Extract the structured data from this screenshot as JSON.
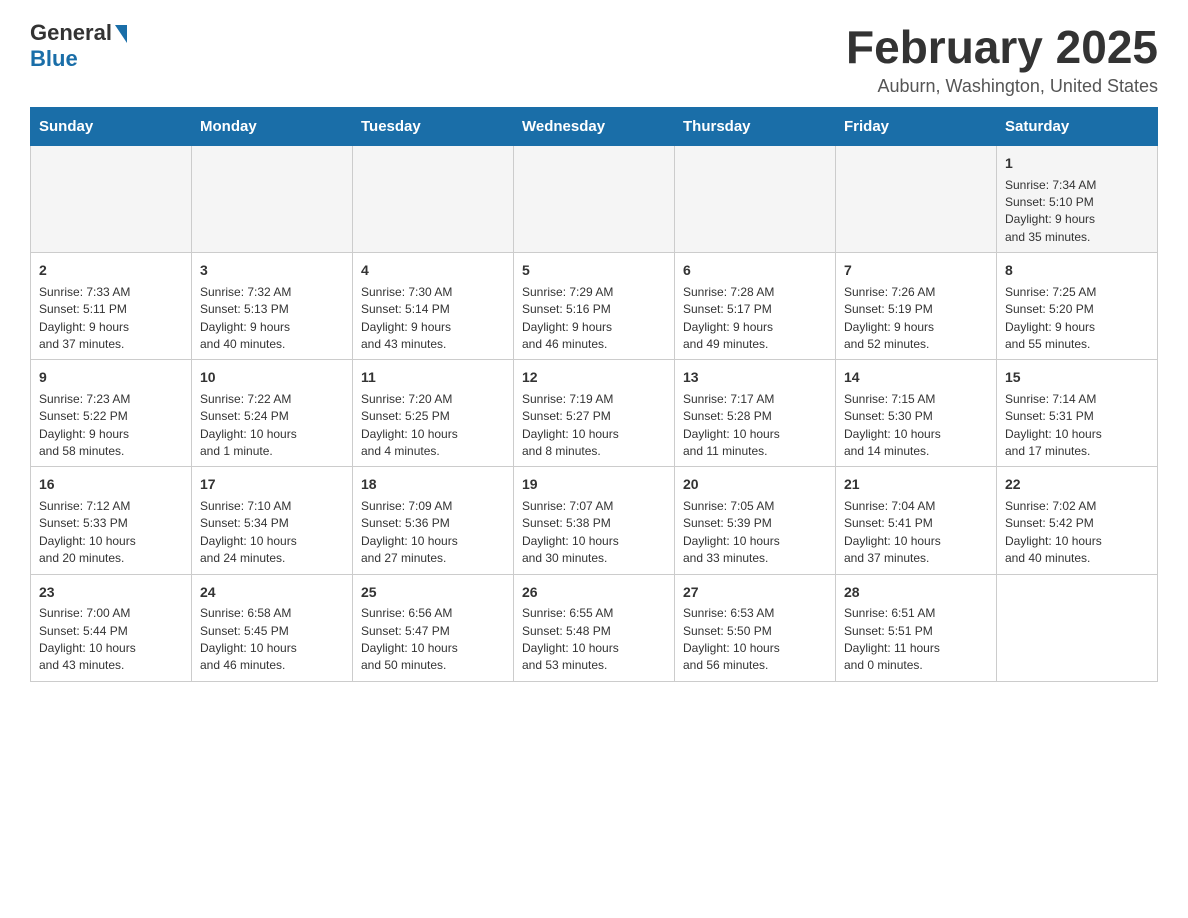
{
  "header": {
    "logo_general": "General",
    "logo_blue": "Blue",
    "month_title": "February 2025",
    "location": "Auburn, Washington, United States"
  },
  "weekdays": [
    "Sunday",
    "Monday",
    "Tuesday",
    "Wednesday",
    "Thursday",
    "Friday",
    "Saturday"
  ],
  "weeks": [
    [
      {
        "day": "",
        "info": ""
      },
      {
        "day": "",
        "info": ""
      },
      {
        "day": "",
        "info": ""
      },
      {
        "day": "",
        "info": ""
      },
      {
        "day": "",
        "info": ""
      },
      {
        "day": "",
        "info": ""
      },
      {
        "day": "1",
        "info": "Sunrise: 7:34 AM\nSunset: 5:10 PM\nDaylight: 9 hours\nand 35 minutes."
      }
    ],
    [
      {
        "day": "2",
        "info": "Sunrise: 7:33 AM\nSunset: 5:11 PM\nDaylight: 9 hours\nand 37 minutes."
      },
      {
        "day": "3",
        "info": "Sunrise: 7:32 AM\nSunset: 5:13 PM\nDaylight: 9 hours\nand 40 minutes."
      },
      {
        "day": "4",
        "info": "Sunrise: 7:30 AM\nSunset: 5:14 PM\nDaylight: 9 hours\nand 43 minutes."
      },
      {
        "day": "5",
        "info": "Sunrise: 7:29 AM\nSunset: 5:16 PM\nDaylight: 9 hours\nand 46 minutes."
      },
      {
        "day": "6",
        "info": "Sunrise: 7:28 AM\nSunset: 5:17 PM\nDaylight: 9 hours\nand 49 minutes."
      },
      {
        "day": "7",
        "info": "Sunrise: 7:26 AM\nSunset: 5:19 PM\nDaylight: 9 hours\nand 52 minutes."
      },
      {
        "day": "8",
        "info": "Sunrise: 7:25 AM\nSunset: 5:20 PM\nDaylight: 9 hours\nand 55 minutes."
      }
    ],
    [
      {
        "day": "9",
        "info": "Sunrise: 7:23 AM\nSunset: 5:22 PM\nDaylight: 9 hours\nand 58 minutes."
      },
      {
        "day": "10",
        "info": "Sunrise: 7:22 AM\nSunset: 5:24 PM\nDaylight: 10 hours\nand 1 minute."
      },
      {
        "day": "11",
        "info": "Sunrise: 7:20 AM\nSunset: 5:25 PM\nDaylight: 10 hours\nand 4 minutes."
      },
      {
        "day": "12",
        "info": "Sunrise: 7:19 AM\nSunset: 5:27 PM\nDaylight: 10 hours\nand 8 minutes."
      },
      {
        "day": "13",
        "info": "Sunrise: 7:17 AM\nSunset: 5:28 PM\nDaylight: 10 hours\nand 11 minutes."
      },
      {
        "day": "14",
        "info": "Sunrise: 7:15 AM\nSunset: 5:30 PM\nDaylight: 10 hours\nand 14 minutes."
      },
      {
        "day": "15",
        "info": "Sunrise: 7:14 AM\nSunset: 5:31 PM\nDaylight: 10 hours\nand 17 minutes."
      }
    ],
    [
      {
        "day": "16",
        "info": "Sunrise: 7:12 AM\nSunset: 5:33 PM\nDaylight: 10 hours\nand 20 minutes."
      },
      {
        "day": "17",
        "info": "Sunrise: 7:10 AM\nSunset: 5:34 PM\nDaylight: 10 hours\nand 24 minutes."
      },
      {
        "day": "18",
        "info": "Sunrise: 7:09 AM\nSunset: 5:36 PM\nDaylight: 10 hours\nand 27 minutes."
      },
      {
        "day": "19",
        "info": "Sunrise: 7:07 AM\nSunset: 5:38 PM\nDaylight: 10 hours\nand 30 minutes."
      },
      {
        "day": "20",
        "info": "Sunrise: 7:05 AM\nSunset: 5:39 PM\nDaylight: 10 hours\nand 33 minutes."
      },
      {
        "day": "21",
        "info": "Sunrise: 7:04 AM\nSunset: 5:41 PM\nDaylight: 10 hours\nand 37 minutes."
      },
      {
        "day": "22",
        "info": "Sunrise: 7:02 AM\nSunset: 5:42 PM\nDaylight: 10 hours\nand 40 minutes."
      }
    ],
    [
      {
        "day": "23",
        "info": "Sunrise: 7:00 AM\nSunset: 5:44 PM\nDaylight: 10 hours\nand 43 minutes."
      },
      {
        "day": "24",
        "info": "Sunrise: 6:58 AM\nSunset: 5:45 PM\nDaylight: 10 hours\nand 46 minutes."
      },
      {
        "day": "25",
        "info": "Sunrise: 6:56 AM\nSunset: 5:47 PM\nDaylight: 10 hours\nand 50 minutes."
      },
      {
        "day": "26",
        "info": "Sunrise: 6:55 AM\nSunset: 5:48 PM\nDaylight: 10 hours\nand 53 minutes."
      },
      {
        "day": "27",
        "info": "Sunrise: 6:53 AM\nSunset: 5:50 PM\nDaylight: 10 hours\nand 56 minutes."
      },
      {
        "day": "28",
        "info": "Sunrise: 6:51 AM\nSunset: 5:51 PM\nDaylight: 11 hours\nand 0 minutes."
      },
      {
        "day": "",
        "info": ""
      }
    ]
  ]
}
